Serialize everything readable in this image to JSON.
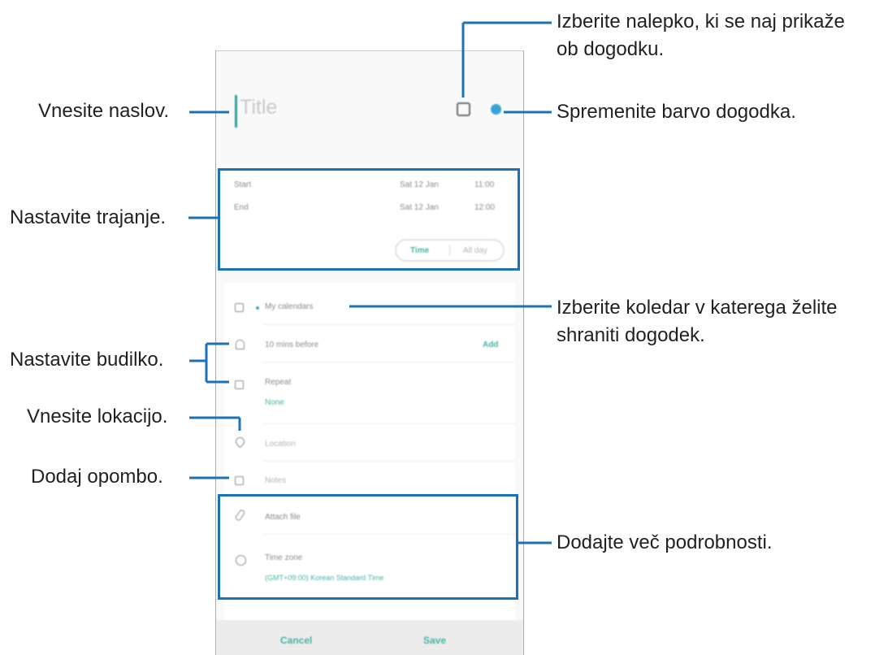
{
  "event_form": {
    "title_placeholder": "Title",
    "start_label": "Start",
    "start_date": "Sat 12 Jan",
    "start_time": "11:00",
    "end_label": "End",
    "end_date": "Sat 12 Jan",
    "end_time": "12:00",
    "time_tab": "Time",
    "all_day_tab": "All day",
    "calendar": "My calendars",
    "reminder": "10 mins before",
    "reminder_add": "Add",
    "repeat_label": "Repeat",
    "repeat_value": "None",
    "location_placeholder": "Location",
    "notes_placeholder": "Notes",
    "attach_label": "Attach file",
    "timezone_label": "Time zone",
    "timezone_value": "(GMT+09:00) Korean Standard Time",
    "cancel_button": "Cancel",
    "save_button": "Save"
  },
  "callouts": {
    "sticker_line1": "Izberite nalepko, ki se naj prikaže",
    "sticker_line2": "ob dogodku.",
    "title": "Vnesite naslov.",
    "color": "Spremenite barvo dogodka.",
    "duration": "Nastavite trajanje.",
    "calendar_line1": "Izberite koledar v katerega želite",
    "calendar_line2": "shraniti dogodek.",
    "alarm": "Nastavite budilko.",
    "location": "Vnesite lokacijo.",
    "note": "Dodaj opombo.",
    "details": "Dodajte več podrobnosti."
  },
  "colors": {
    "accent": "#46b2a3",
    "event_color": "#3aa3d6",
    "highlight": "#1b72b8"
  }
}
